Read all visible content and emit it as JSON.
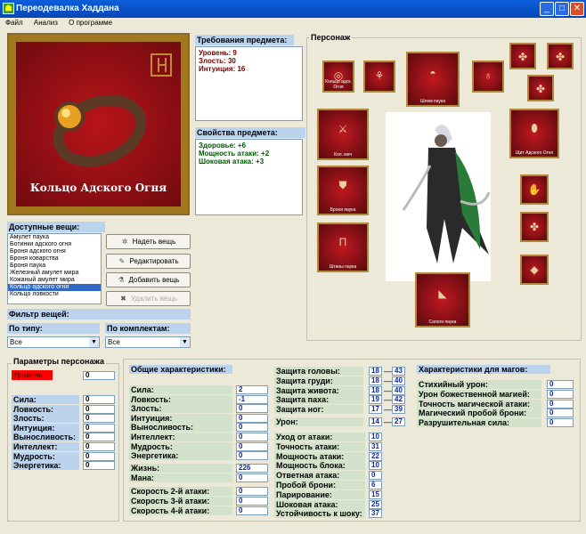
{
  "window": {
    "title": "Переодевалка Хаддана",
    "buttons": [
      "_",
      "□",
      "✕"
    ]
  },
  "menu": [
    "Файл",
    "Анализ",
    "О программе"
  ],
  "item_image": {
    "name": "Кольцо Адского Огня"
  },
  "requirements": {
    "title": "Требования предмета:",
    "lines": [
      "Уровень: 9",
      "Злость: 30",
      "Интуиция: 16"
    ]
  },
  "properties": {
    "title": "Свойства предмета:",
    "lines": [
      "Здоровье: +6",
      "Мощность атаки: +2",
      "Шоковая атака: +3"
    ]
  },
  "available": {
    "title": "Доступные вещи:",
    "items": [
      "Амулет паука",
      "Ботинки адского огня",
      "Броня адского огня",
      "Броня коварства",
      "Броня паука",
      "Железный амулет мира",
      "Кожаный амулет мира",
      "Кольцо адского огня",
      "Кольцо ловкости"
    ],
    "selected_index": 7
  },
  "buttons": {
    "wear": "Надеть вещь",
    "edit": "Редактировать",
    "add": "Добавить вещь",
    "delete": "Удалить вещь"
  },
  "filter": {
    "title": "Фильтр вещей:",
    "by_type": "По типу:",
    "by_set": "По комплектам:",
    "type_value": "Все",
    "set_value": "Все"
  },
  "character": {
    "title": "Персонаж",
    "slots": [
      {
        "caption": "Кольцо адск. Огня",
        "glyph": "◎"
      },
      {
        "caption": "",
        "glyph": "⚘"
      },
      {
        "caption": "Шлем паука",
        "glyph": "◓"
      },
      {
        "caption": "",
        "glyph": "♁"
      },
      {
        "caption": "",
        "glyph": "✤"
      },
      {
        "caption": "",
        "glyph": "✤"
      },
      {
        "caption": "",
        "glyph": "✤"
      },
      {
        "caption": "Кол. меч",
        "glyph": "⚔"
      },
      {
        "caption": "Щит Адского Огня",
        "glyph": "⬮"
      },
      {
        "caption": "Броня паука",
        "glyph": "⛊"
      },
      {
        "caption": "",
        "glyph": "✋"
      },
      {
        "caption": "Штаны паука",
        "glyph": "Π"
      },
      {
        "caption": "",
        "glyph": "✤"
      },
      {
        "caption": "",
        "glyph": "◆"
      },
      {
        "caption": "Сапоги паука",
        "glyph": "◣"
      }
    ]
  },
  "params": {
    "title": "Параметры персонажа",
    "level_label": "Уровень",
    "level_value": "0",
    "stats": [
      {
        "label": "Сила:",
        "value": "0"
      },
      {
        "label": "Ловкость:",
        "value": "0"
      },
      {
        "label": "Злость:",
        "value": "0"
      },
      {
        "label": "Интуиция:",
        "value": "0"
      },
      {
        "label": "Выносливость:",
        "value": "0"
      },
      {
        "label": "Интеллект:",
        "value": "0"
      },
      {
        "label": "Мудрость:",
        "value": "0"
      },
      {
        "label": "Энергетика:",
        "value": "0"
      }
    ]
  },
  "general": {
    "title": "Общие характеристики:",
    "stats": [
      {
        "label": "Сила:",
        "value": "2"
      },
      {
        "label": "Ловкость:",
        "value": "-1"
      },
      {
        "label": "Злость:",
        "value": "0"
      },
      {
        "label": "Интуиция:",
        "value": "0"
      },
      {
        "label": "Выносливость:",
        "value": "0"
      },
      {
        "label": "Интеллект:",
        "value": "0"
      },
      {
        "label": "Мудрость:",
        "value": "0"
      },
      {
        "label": "Энергетика:",
        "value": "0"
      }
    ],
    "life_label": "Жизнь:",
    "life_value": "226",
    "mana_label": "Мана:",
    "mana_value": "0",
    "speeds": [
      {
        "label": "Скорость 2-й атаки:",
        "value": "0"
      },
      {
        "label": "Скорость 3-й атаки:",
        "value": "0"
      },
      {
        "label": "Скорость 4-й атаки:",
        "value": "0"
      }
    ]
  },
  "protection": {
    "rows": [
      {
        "label": "Защита головы:",
        "min": "18",
        "max": "43"
      },
      {
        "label": "Защита груди:",
        "min": "18",
        "max": "40"
      },
      {
        "label": "Защита живота:",
        "min": "18",
        "max": "40"
      },
      {
        "label": "Защита паха:",
        "min": "19",
        "max": "42"
      },
      {
        "label": "Защита ног:",
        "min": "17",
        "max": "39"
      }
    ],
    "damage_label": "Урон:",
    "damage_min": "14",
    "damage_max": "27",
    "combat": [
      {
        "label": "Уход от атаки:",
        "value": "10"
      },
      {
        "label": "Точность атаки:",
        "value": "31"
      },
      {
        "label": "Мощность атаки:",
        "value": "22"
      },
      {
        "label": "Мощность блока:",
        "value": "10"
      },
      {
        "label": "Ответная атака:",
        "value": "0"
      },
      {
        "label": "Пробой брони:",
        "value": "6"
      },
      {
        "label": "Парирование:",
        "value": "15"
      },
      {
        "label": "Шоковая атака:",
        "value": "25"
      },
      {
        "label": "Устойчивость к шоку:",
        "value": "37"
      }
    ]
  },
  "magic": {
    "title": "Характеристики для магов:",
    "stats": [
      {
        "label": "Стихийный урон:",
        "value": "0"
      },
      {
        "label": "Урон божественной магией:",
        "value": "0"
      },
      {
        "label": "Точность магической атаки:",
        "value": "0"
      },
      {
        "label": "Магический пробой брони:",
        "value": "0"
      },
      {
        "label": "Разрушительная сила:",
        "value": "0"
      }
    ]
  }
}
